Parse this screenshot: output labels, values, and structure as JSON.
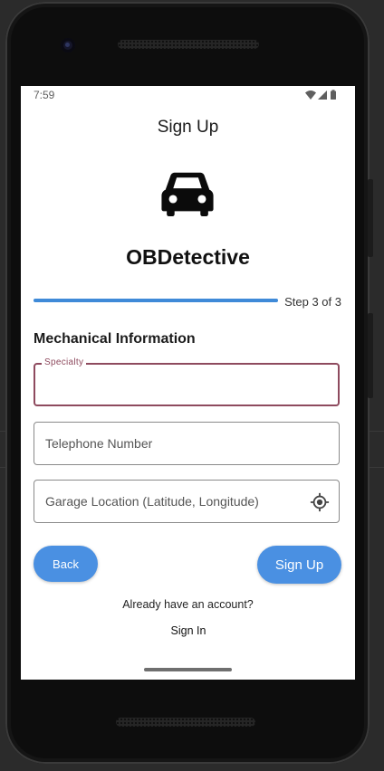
{
  "status_bar": {
    "time": "7:59",
    "icons": [
      "wifi-icon",
      "signal-icon",
      "battery-icon"
    ]
  },
  "app_bar": {
    "title": "Sign Up"
  },
  "logo": {
    "icon": "car-icon",
    "brand": "OBDetective"
  },
  "progress": {
    "value": 1.0,
    "step_text": "Step 3 of 3",
    "color": "#3f8ad8"
  },
  "form": {
    "section_title": "Mechanical Information",
    "specialty": {
      "label": "Specialty",
      "value": ""
    },
    "telephone": {
      "placeholder": "Telephone Number",
      "value": ""
    },
    "garage_location": {
      "placeholder": "Garage Location (Latitude, Longitude)",
      "value": "",
      "icon": "my-location-icon"
    }
  },
  "actions": {
    "back_label": "Back",
    "signup_label": "Sign Up",
    "button_color": "#4a90e2"
  },
  "footer": {
    "prompt": "Already have an account?",
    "signin_label": "Sign In"
  },
  "colors": {
    "focus": "#8e4a5e"
  }
}
